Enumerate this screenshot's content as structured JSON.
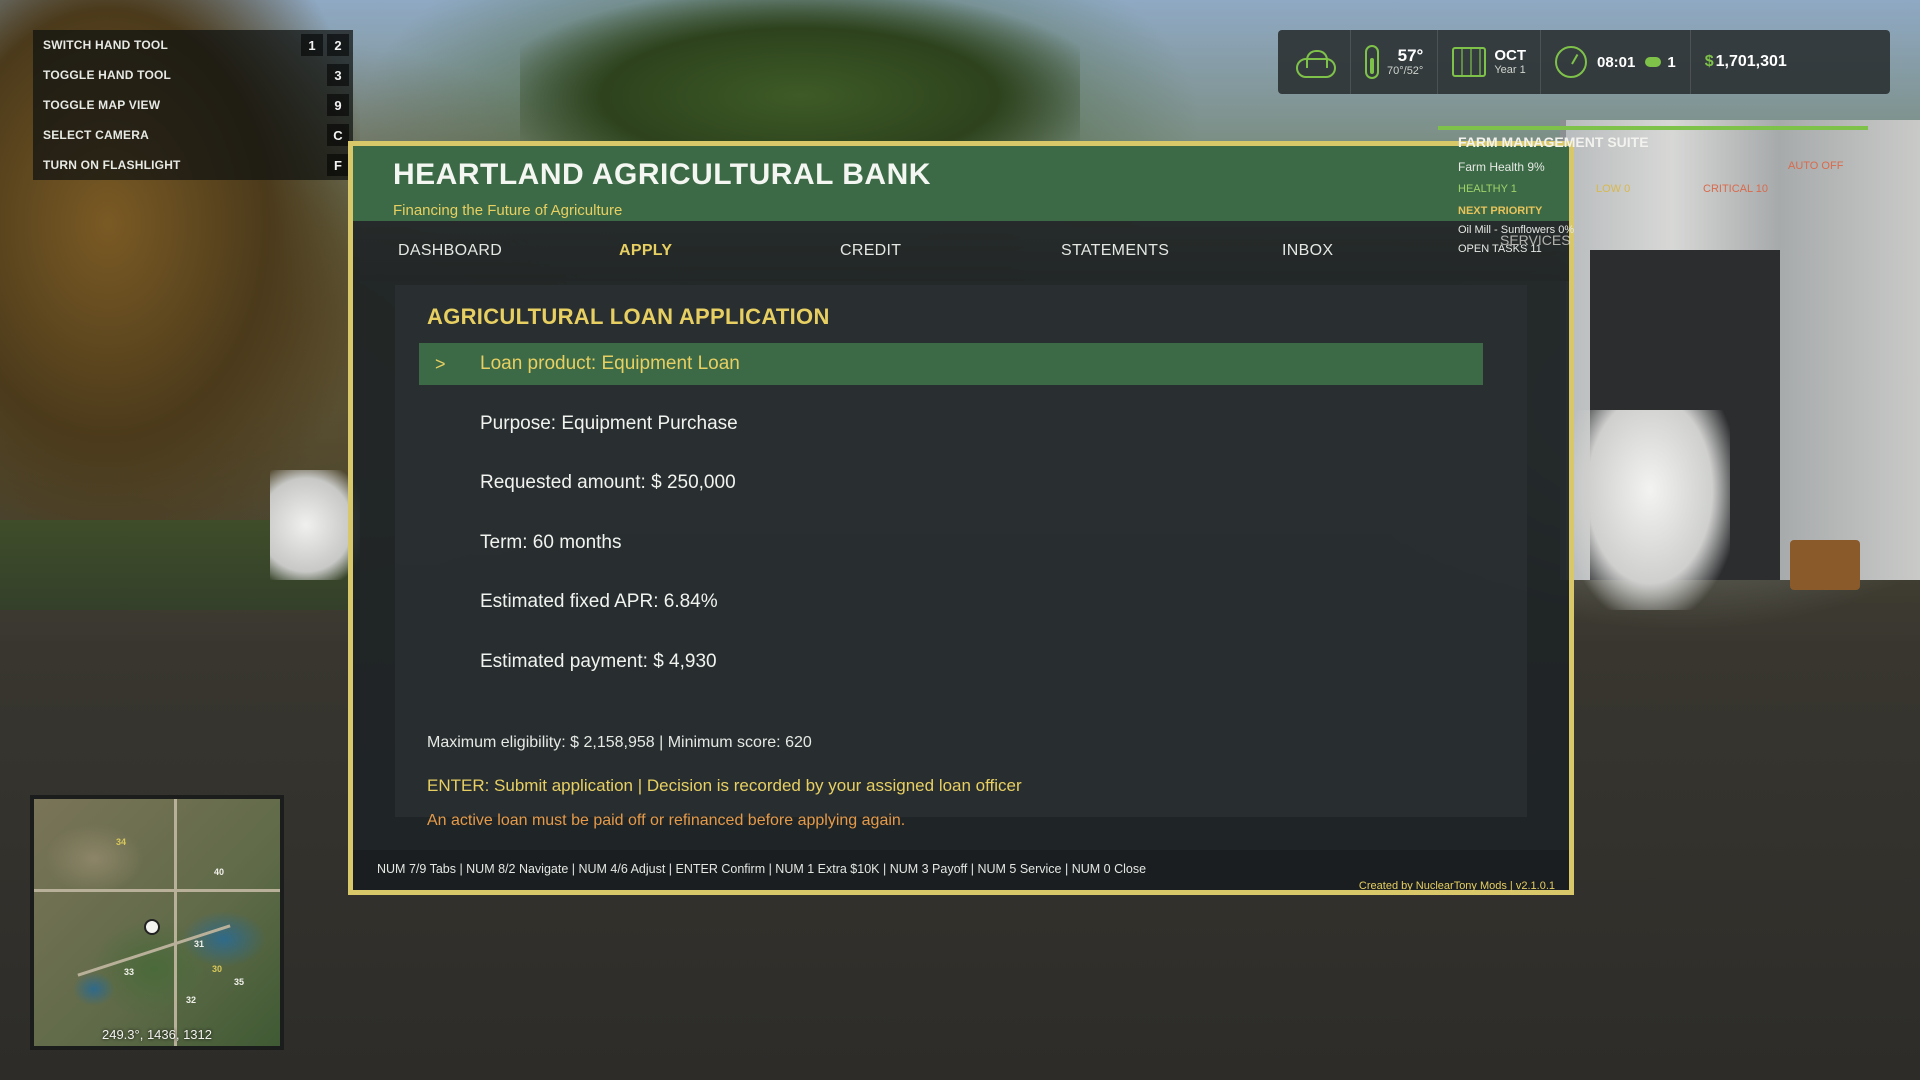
{
  "keybinds": [
    {
      "label": "SWITCH HAND TOOL",
      "keys": [
        "1",
        "2"
      ]
    },
    {
      "label": "TOGGLE HAND TOOL",
      "keys": [
        "3"
      ]
    },
    {
      "label": "TOGGLE MAP VIEW",
      "keys": [
        "9"
      ]
    },
    {
      "label": "SELECT CAMERA",
      "keys": [
        "C"
      ]
    },
    {
      "label": "TURN ON FLASHLIGHT",
      "keys": [
        "F"
      ]
    }
  ],
  "status": {
    "weather_icon": "cloud-icon",
    "temperature": "57°",
    "temp_range": "70°/52°",
    "month": "OCT",
    "year": "Year 1",
    "time": "08:01",
    "speed": "1",
    "money_symbol": "$",
    "money": "1,701,301"
  },
  "fms": {
    "title": "FARM MANAGEMENT SUITE",
    "health": "Farm Health  9%",
    "healthy": "HEALTHY 1",
    "low": "LOW 0",
    "critical": "CRITICAL 10",
    "auto": "AUTO OFF",
    "next_priority": "NEXT PRIORITY",
    "task": "Oil Mill - Sunflowers 0%",
    "open_tasks": "OPEN TASKS  11",
    "services": "SERVICES"
  },
  "bank": {
    "title": "HEARTLAND AGRICULTURAL BANK",
    "subtitle": "Financing the Future of Agriculture",
    "tabs": [
      {
        "label": "DASHBOARD",
        "active": false
      },
      {
        "label": "APPLY",
        "active": true
      },
      {
        "label": "CREDIT",
        "active": false
      },
      {
        "label": "STATEMENTS",
        "active": false
      },
      {
        "label": "INBOX",
        "active": false
      }
    ],
    "section_title": "AGRICULTURAL LOAN APPLICATION",
    "selected_marker": ">",
    "fields": [
      "Loan product: Equipment Loan",
      "Purpose: Equipment Purchase",
      "Requested amount: $ 250,000",
      "Term: 60 months",
      "Estimated fixed APR: 6.84%",
      "Estimated payment: $ 4,930"
    ],
    "eligibility": "Maximum eligibility: $ 2,158,958 | Minimum score: 620",
    "submit_hint": "ENTER: Submit application | Decision is recorded by your assigned loan officer",
    "warning": "An active loan must be paid off or refinanced before applying again.",
    "footer_keys": "NUM 7/9 Tabs | NUM 8/2 Navigate | NUM 4/6 Adjust | ENTER Confirm | NUM 1 Extra $10K | NUM 3 Payoff | NUM 5 Service | NUM 0 Close",
    "credit": "Created by NuclearTony Mods | v2.1.0.1"
  },
  "minimap": {
    "coords": "249.3°, 1436, 1312",
    "labels": [
      "34",
      "40",
      "31",
      "30",
      "33",
      "35",
      "32"
    ]
  },
  "colors": {
    "accent_green": "#3c6a46",
    "accent_gold": "#e7cf62",
    "hud_green": "#7fc24a",
    "border_gold": "#d8c86a",
    "warning_orange": "#e59a4a"
  }
}
